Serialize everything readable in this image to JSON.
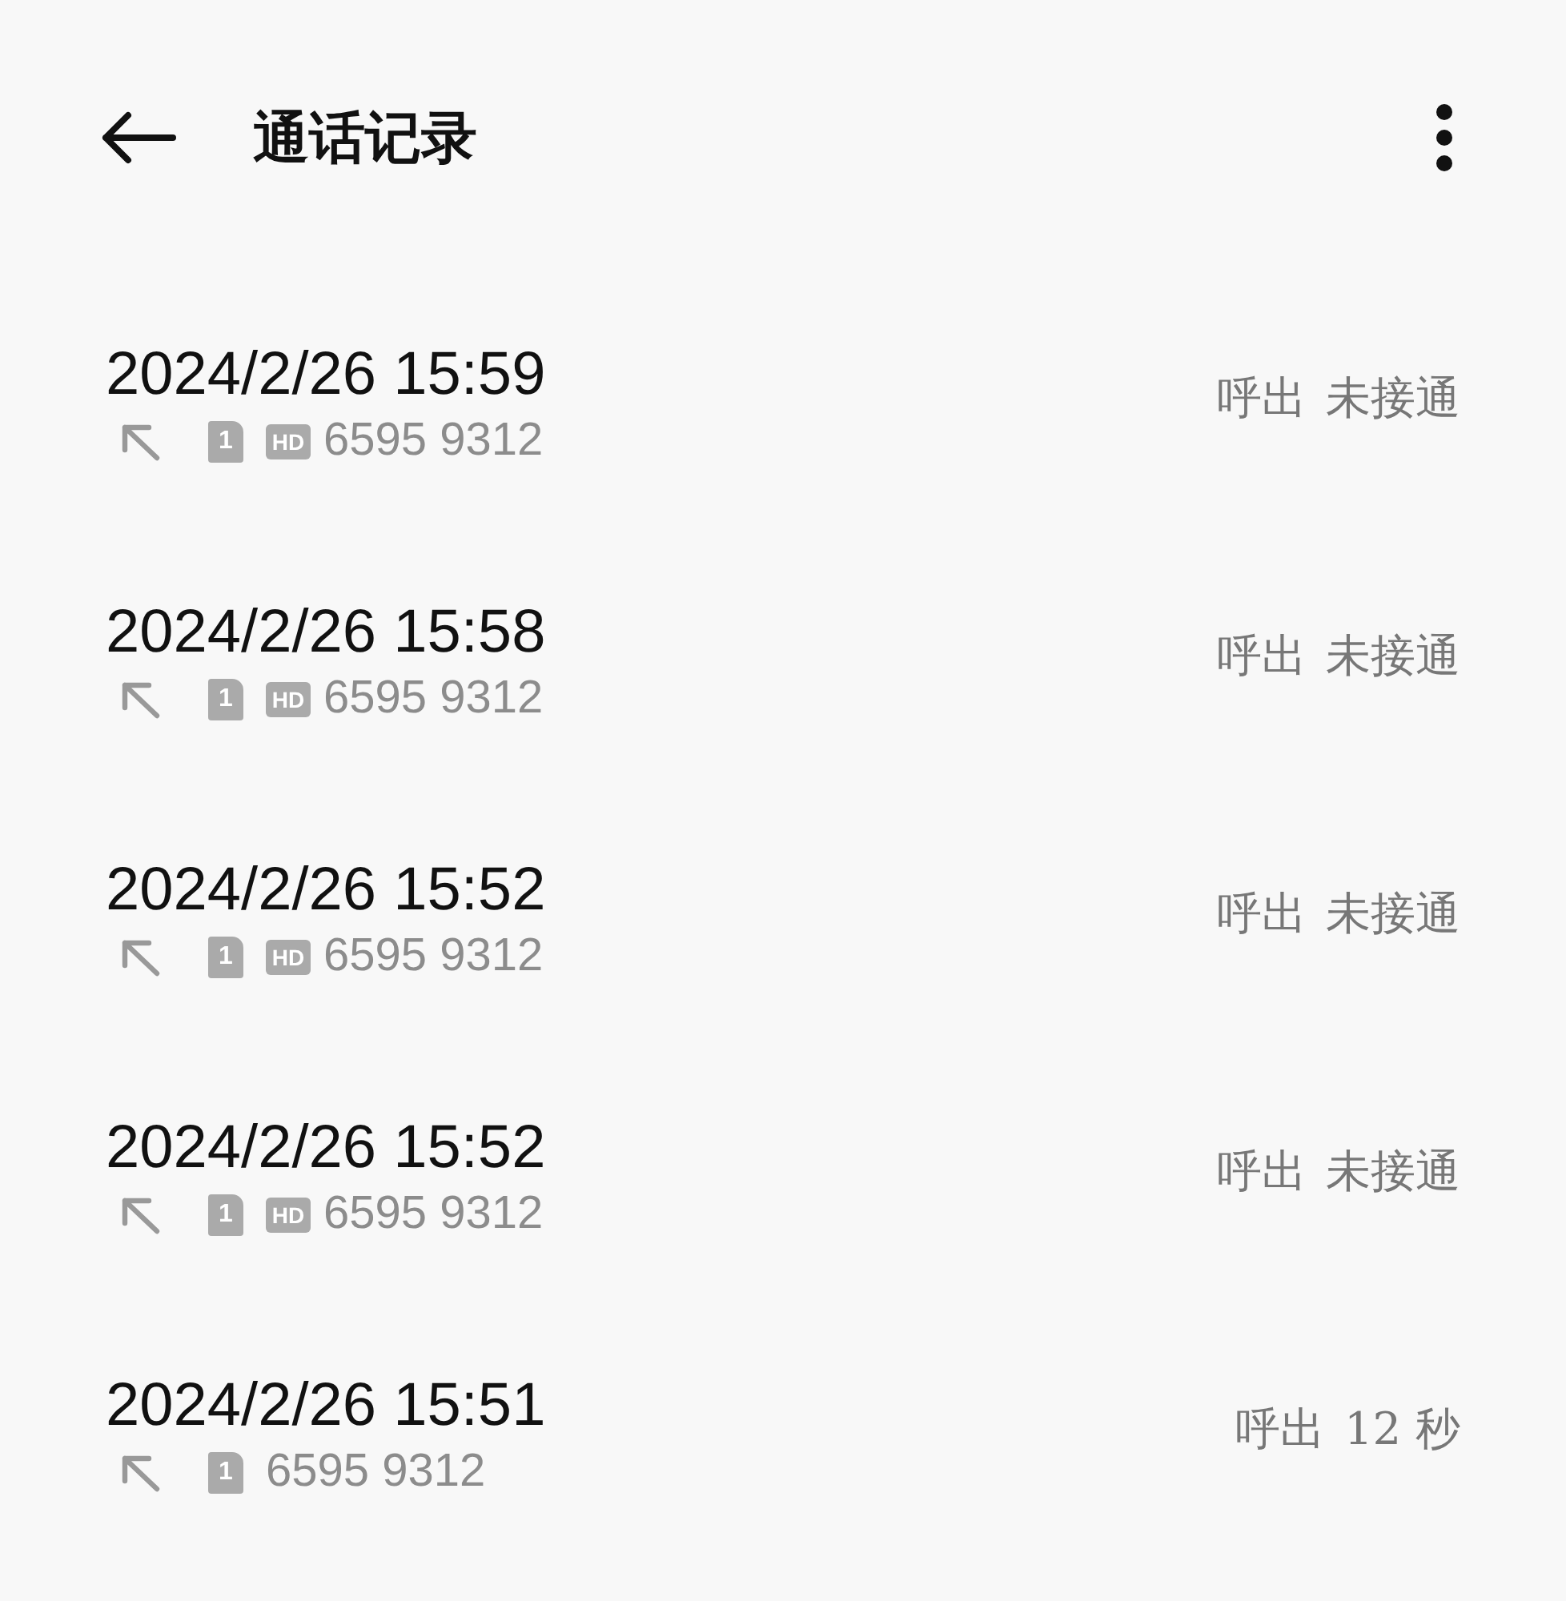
{
  "header": {
    "title": "通话记录"
  },
  "calls": [
    {
      "time": "2024/2/26 15:59",
      "sim": "1",
      "hd": "HD",
      "number": "6595 9312",
      "direction": "呼出",
      "result": "未接通"
    },
    {
      "time": "2024/2/26 15:58",
      "sim": "1",
      "hd": "HD",
      "number": "6595 9312",
      "direction": "呼出",
      "result": "未接通"
    },
    {
      "time": "2024/2/26 15:52",
      "sim": "1",
      "hd": "HD",
      "number": "6595 9312",
      "direction": "呼出",
      "result": "未接通"
    },
    {
      "time": "2024/2/26 15:52",
      "sim": "1",
      "hd": "HD",
      "number": "6595 9312",
      "direction": "呼出",
      "result": "未接通"
    },
    {
      "time": "2024/2/26 15:51",
      "sim": "1",
      "number": "6595 9312",
      "direction": "呼出",
      "result": "12 秒"
    }
  ]
}
